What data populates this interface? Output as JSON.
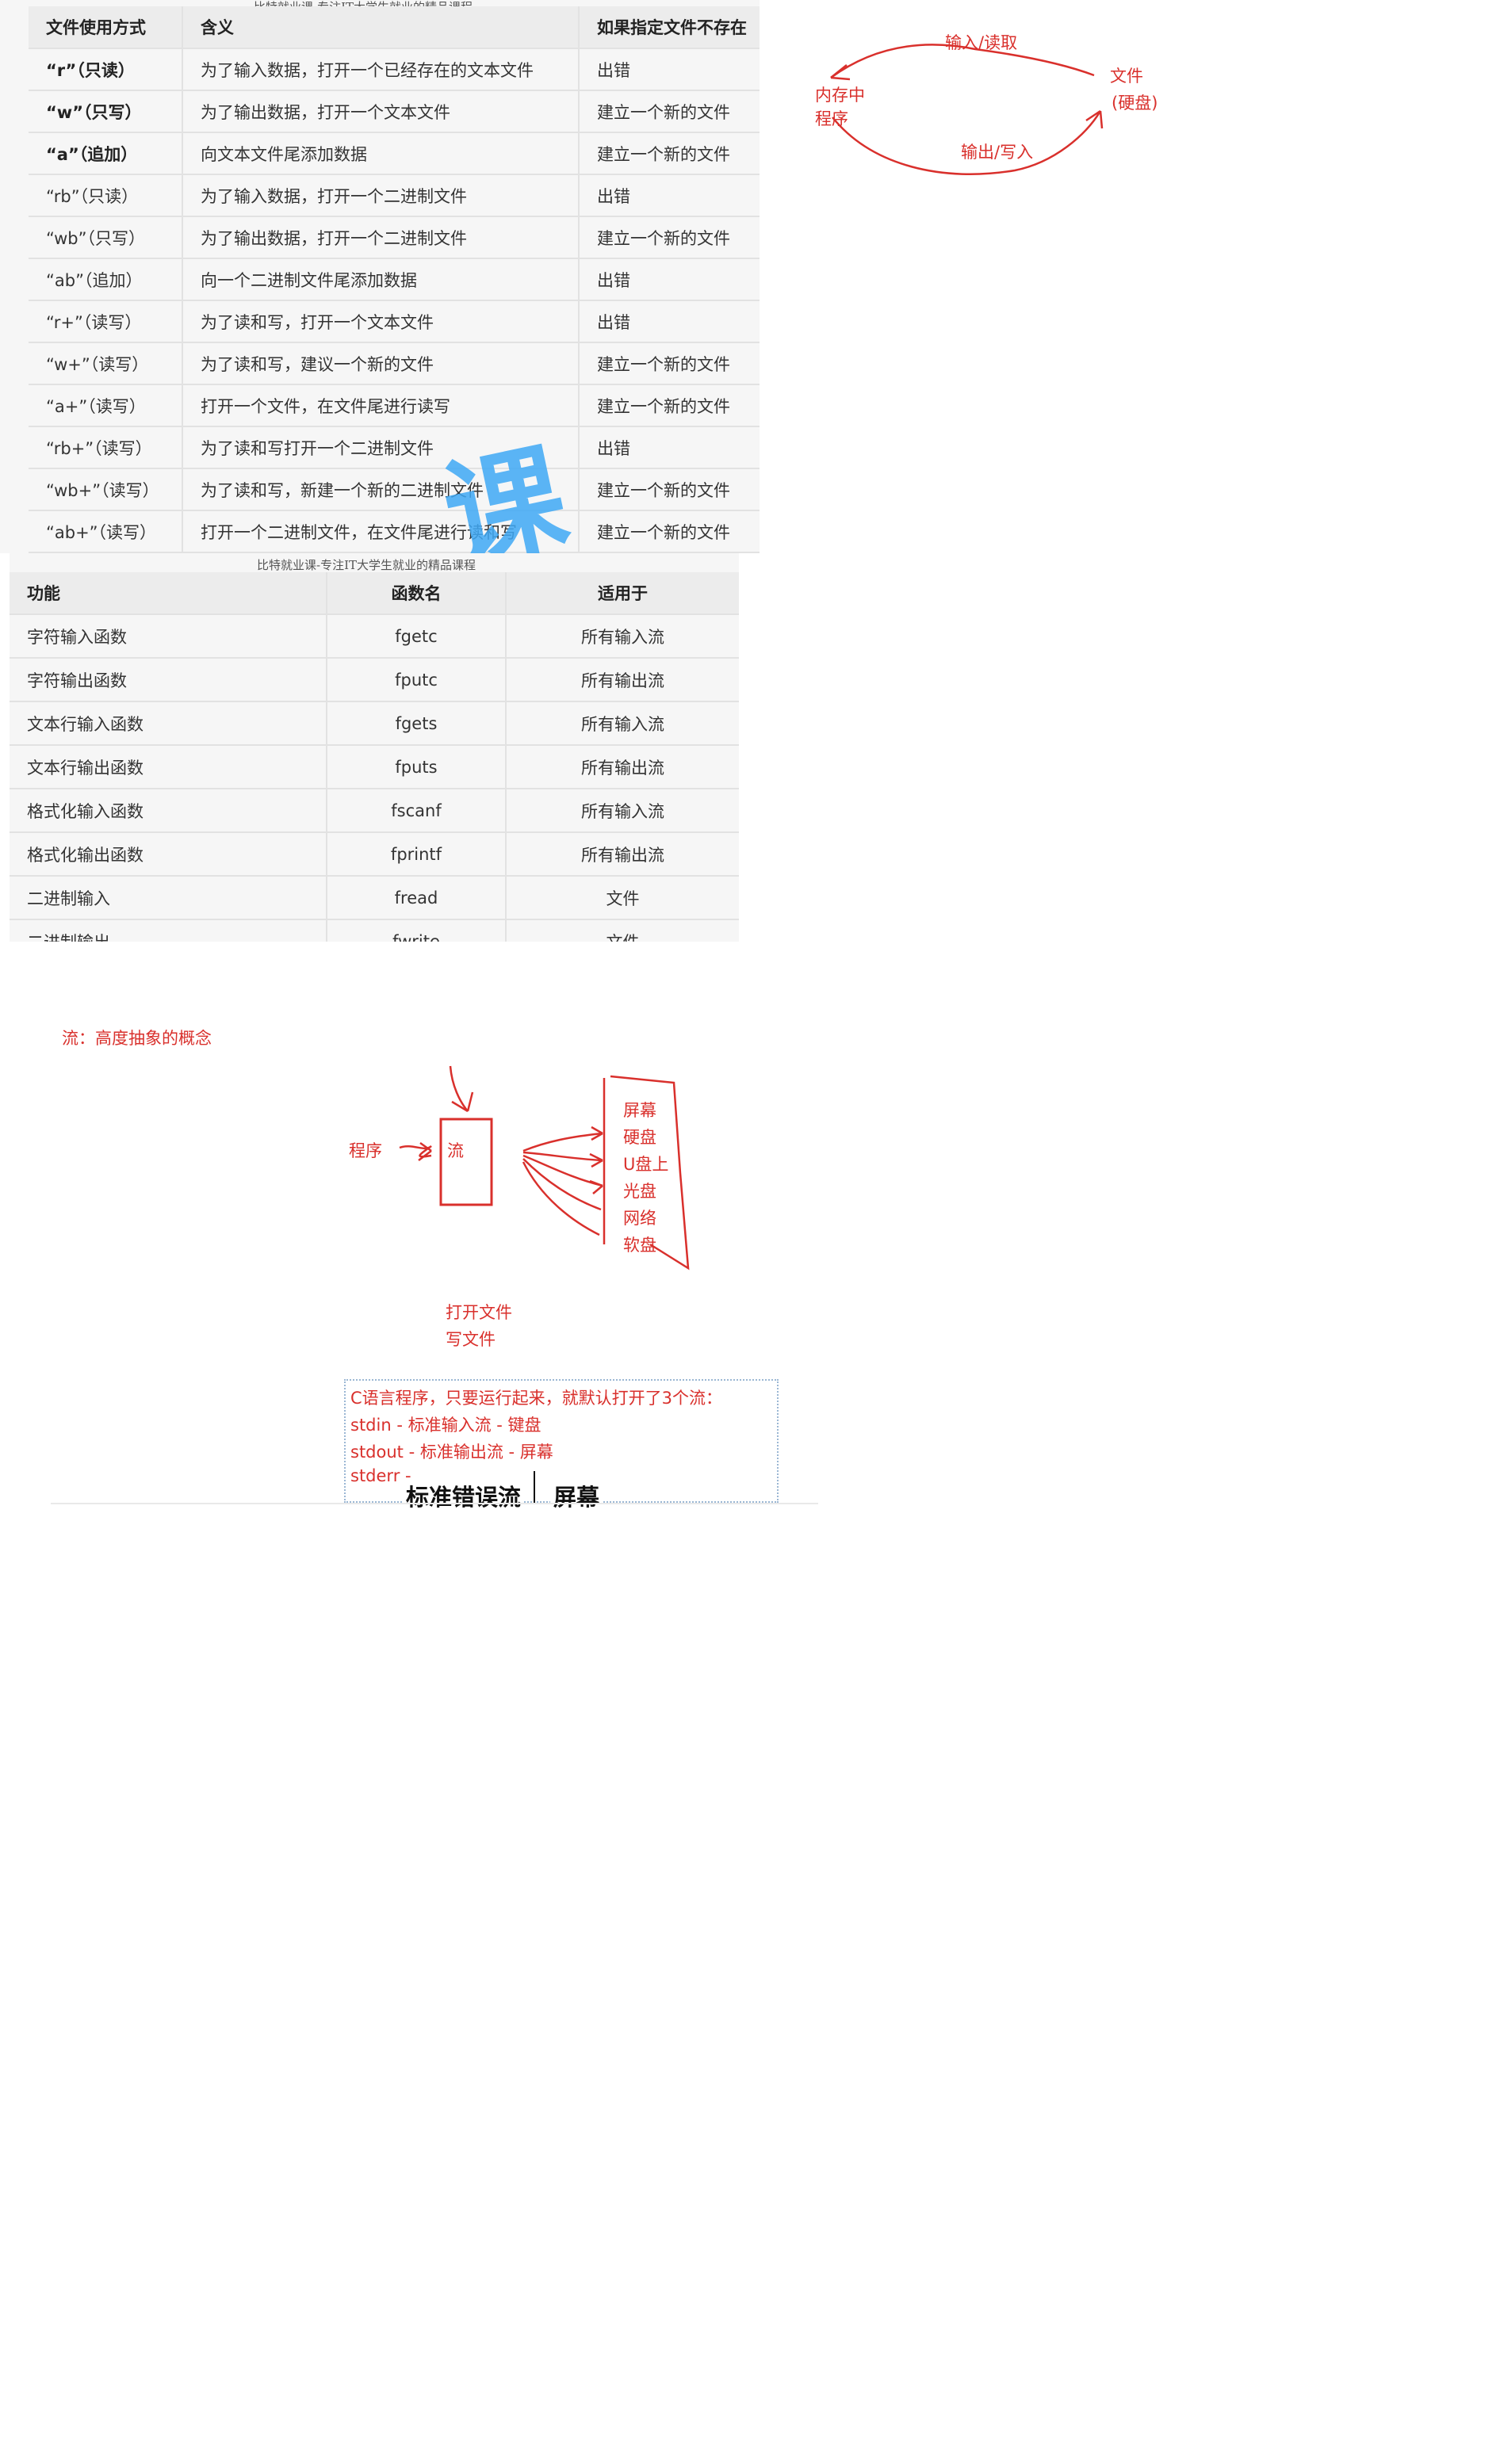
{
  "table1": {
    "watermark": "比特就业课-专注IT大学生就业的精品课程",
    "headers": [
      "文件使用方式",
      "含义",
      "如果指定文件不存在"
    ],
    "rows": [
      {
        "mode": "“r”（只读）",
        "meaning": "为了输入数据，打开一个已经存在的文本文件",
        "missing": "出错"
      },
      {
        "mode": "“w”（只写）",
        "meaning": "为了输出数据，打开一个文本文件",
        "missing": "建立一个新的文件"
      },
      {
        "mode": "“a”（追加）",
        "meaning": "向文本文件尾添加数据",
        "missing": "建立一个新的文件"
      },
      {
        "mode": "“rb”（只读）",
        "meaning": "为了输入数据，打开一个二进制文件",
        "missing": "出错"
      },
      {
        "mode": "“wb”（只写）",
        "meaning": "为了输出数据，打开一个二进制文件",
        "missing": "建立一个新的文件"
      },
      {
        "mode": "“ab”（追加）",
        "meaning": "向一个二进制文件尾添加数据",
        "missing": "出错"
      },
      {
        "mode": "“r+”（读写）",
        "meaning": "为了读和写，打开一个文本文件",
        "missing": "出错"
      },
      {
        "mode": "“w+”（读写）",
        "meaning": "为了读和写，建议一个新的文件",
        "missing": "建立一个新的文件"
      },
      {
        "mode": "“a+”（读写）",
        "meaning": "打开一个文件，在文件尾进行读写",
        "missing": "建立一个新的文件"
      },
      {
        "mode": "“rb+”（读写）",
        "meaning": "为了读和写打开一个二进制文件",
        "missing": "出错"
      },
      {
        "mode": "“wb+”（读写）",
        "meaning": "为了读和写，新建一个新的二进制文件",
        "missing": "建立一个新的文件"
      },
      {
        "mode": "“ab+”（读写）",
        "meaning": "打开一个二进制文件，在文件尾进行读和写",
        "missing": "建立一个新的文件"
      }
    ]
  },
  "watermark_large": "课",
  "table2": {
    "watermark": "比特就业课-专注IT大学生就业的精品课程",
    "headers": [
      "功能",
      "函数名",
      "适用于"
    ],
    "rows": [
      {
        "func": "字符输入函数",
        "name": "fgetc",
        "for": "所有输入流"
      },
      {
        "func": "字符输出函数",
        "name": "fputc",
        "for": "所有输出流"
      },
      {
        "func": "文本行输入函数",
        "name": "fgets",
        "for": "所有输入流"
      },
      {
        "func": "文本行输出函数",
        "name": "fputs",
        "for": "所有输出流"
      },
      {
        "func": "格式化输入函数",
        "name": "fscanf",
        "for": "所有输入流"
      },
      {
        "func": "格式化输出函数",
        "name": "fprintf",
        "for": "所有输出流"
      },
      {
        "func": "二进制输入",
        "name": "fread",
        "for": "文件"
      },
      {
        "func": "二进制输出",
        "name": "fwrite",
        "for": "文件"
      }
    ]
  },
  "diagram_io": {
    "read_label": "输入/读取",
    "write_label": "输出/写入",
    "memory_label_1": "内存中",
    "memory_label_2": "程序",
    "file_label_1": "文件",
    "file_label_2": "(硬盘)"
  },
  "stream": {
    "heading": "流：高度抽象的概念",
    "program": "程序",
    "stream": "流",
    "targets": [
      "屏幕",
      "硬盘",
      "U盘上",
      "光盘",
      "网络",
      "软盘"
    ],
    "open_file": "打开文件",
    "write_file": "写文件"
  },
  "std_box": {
    "line1": "C语言程序，只要运行起来，就默认打开了3个流：",
    "line2": "stdin - 标准输入流 - 键盘",
    "line3": "stdout - 标准输出流 - 屏幕",
    "line4": "stderr -",
    "overlay_1": "标准错误流",
    "overlay_2": "屏幕"
  },
  "colors": {
    "annotation_red": "#d9302c",
    "watermark_blue": "#3fa9f5"
  }
}
